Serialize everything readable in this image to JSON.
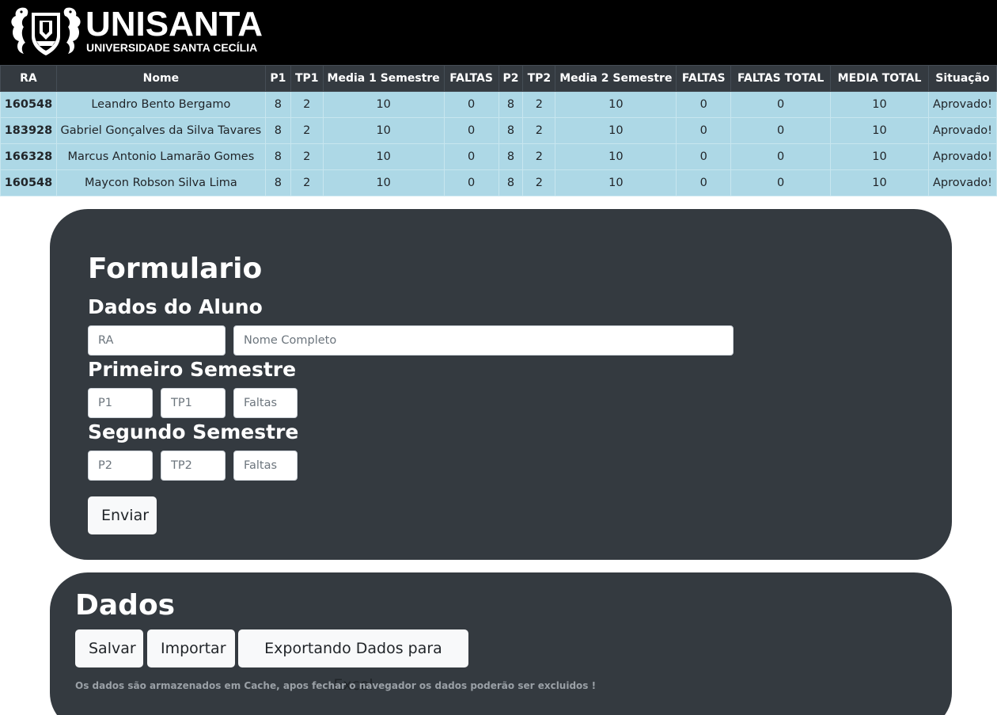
{
  "header": {
    "logo_title": "UNISANTA",
    "logo_subtitle": "UNIVERSIDADE SANTA CECÍLIA"
  },
  "table": {
    "columns": [
      "RA",
      "Nome",
      "P1",
      "TP1",
      "Media 1 Semestre",
      "FALTAS",
      "P2",
      "TP2",
      "Media 2 Semestre",
      "FALTAS",
      "FALTAS TOTAL",
      "MEDIA TOTAL",
      "Situação"
    ],
    "rows": [
      [
        "160548",
        "Leandro Bento Bergamo",
        "8",
        "2",
        "10",
        "0",
        "8",
        "2",
        "10",
        "0",
        "0",
        "10",
        "Aprovado!"
      ],
      [
        "183928",
        "Gabriel Gonçalves da Silva Tavares",
        "8",
        "2",
        "10",
        "0",
        "8",
        "2",
        "10",
        "0",
        "0",
        "10",
        "Aprovado!"
      ],
      [
        "166328",
        "Marcus Antonio Lamarão Gomes",
        "8",
        "2",
        "10",
        "0",
        "8",
        "2",
        "10",
        "0",
        "0",
        "10",
        "Aprovado!"
      ],
      [
        "160548",
        "Maycon Robson Silva Lima",
        "8",
        "2",
        "10",
        "0",
        "8",
        "2",
        "10",
        "0",
        "0",
        "10",
        "Aprovado!"
      ]
    ]
  },
  "form": {
    "title": "Formulario",
    "student_heading": "Dados do Aluno",
    "ra_placeholder": "RA",
    "nome_placeholder": "Nome Completo",
    "first_semester_heading": "Primeiro Semestre",
    "p1_placeholder": "P1",
    "tp1_placeholder": "TP1",
    "faltas1_placeholder": "Faltas",
    "second_semester_heading": "Segundo Semestre",
    "p2_placeholder": "P2",
    "tp2_placeholder": "TP2",
    "faltas2_placeholder": "Faltas",
    "submit_label": "Enviar"
  },
  "data_section": {
    "title": "Dados",
    "save_label": "Salvar",
    "import_label": "Importar",
    "export_label": "Exportando Dados para Excel",
    "note": "Os dados são armazenados em Cache, apos fechar o navegador os dados poderão ser excluidos !"
  },
  "colors": {
    "header_bg": "#000000",
    "table_head_bg": "#343a40",
    "row_bg": "#add8e6",
    "panel_bg": "#343a40",
    "button_bg": "#f8f9fa"
  }
}
